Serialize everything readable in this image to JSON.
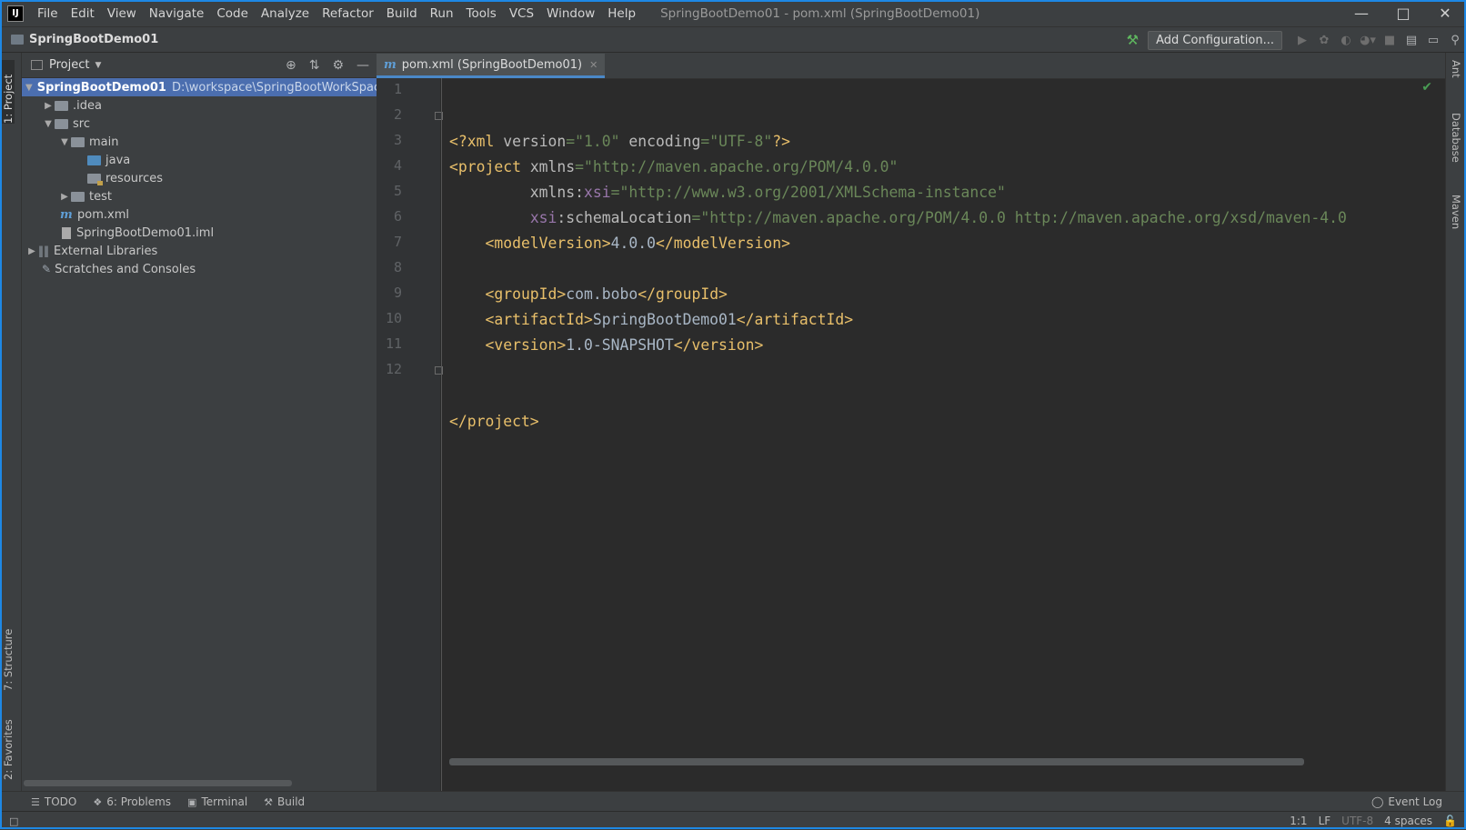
{
  "app": {
    "logo": "IJ",
    "window_title": "SpringBootDemo01 - pom.xml (SpringBootDemo01)",
    "menu": [
      "File",
      "Edit",
      "View",
      "Navigate",
      "Code",
      "Analyze",
      "Refactor",
      "Build",
      "Run",
      "Tools",
      "VCS",
      "Window",
      "Help"
    ]
  },
  "navbar": {
    "breadcrumb": "SpringBootDemo01",
    "add_config": "Add Configuration..."
  },
  "left_strip": {
    "project": "1: Project",
    "structure": "7: Structure",
    "favorites": "2: Favorites"
  },
  "right_strip": {
    "ant": "Ant",
    "database": "Database",
    "maven": "Maven"
  },
  "project_panel": {
    "title": "Project",
    "tree": [
      {
        "name": "SpringBootDemo01",
        "path": "D:\\workspace\\SpringBootWorkSpace\\"
      },
      {
        "name": ".idea"
      },
      {
        "name": "src"
      },
      {
        "name": "main"
      },
      {
        "name": "java"
      },
      {
        "name": "resources"
      },
      {
        "name": "test"
      },
      {
        "name": "pom.xml"
      },
      {
        "name": "SpringBootDemo01.iml"
      },
      {
        "name": "External Libraries"
      },
      {
        "name": "Scratches and Consoles"
      }
    ]
  },
  "editor": {
    "tab_label": "pom.xml (SpringBootDemo01)",
    "line_numbers": [
      "1",
      "2",
      "3",
      "4",
      "5",
      "6",
      "7",
      "8",
      "9",
      "10",
      "11",
      "12"
    ],
    "code": {
      "l1_a": "<?xml ",
      "l1_b": "version",
      "l1_c": "=",
      "l1_d": "\"1.0\"",
      "l1_e": " encoding",
      "l1_f": "=",
      "l1_g": "\"UTF-8\"",
      "l1_h": "?>",
      "l2_a": "<project ",
      "l2_b": "xmlns",
      "l2_c": "=",
      "l2_d": "\"http://maven.apache.org/POM/4.0.0\"",
      "l3_a": "         xmlns:",
      "l3_b": "xsi",
      "l3_c": "=",
      "l3_d": "\"http://www.w3.org/2001/XMLSchema-instance\"",
      "l4_a": "         ",
      "l4_b": "xsi",
      "l4_c": ":schemaLocation",
      "l4_d": "=",
      "l4_e": "\"http://maven.apache.org/POM/4.0.0 http://maven.apache.org/xsd/maven-4.0",
      "l5_a": "    <modelVersion>",
      "l5_b": "4.0.0",
      "l5_c": "</modelVersion>",
      "l7_a": "    <groupId>",
      "l7_b": "com.bobo",
      "l7_c": "</groupId>",
      "l8_a": "    <artifactId>",
      "l8_b": "SpringBootDemo01",
      "l8_c": "</artifactId>",
      "l9_a": "    <version>",
      "l9_b": "1.0-SNAPSHOT",
      "l9_c": "</version>",
      "l12_a": "</project>"
    }
  },
  "bottom_tools": {
    "todo": "TODO",
    "problems": "6: Problems",
    "terminal": "Terminal",
    "build": "Build",
    "event_log": "Event Log"
  },
  "status": {
    "position": "1:1",
    "line_sep": "LF",
    "encoding": "UTF-8",
    "indent": "4 spaces"
  }
}
